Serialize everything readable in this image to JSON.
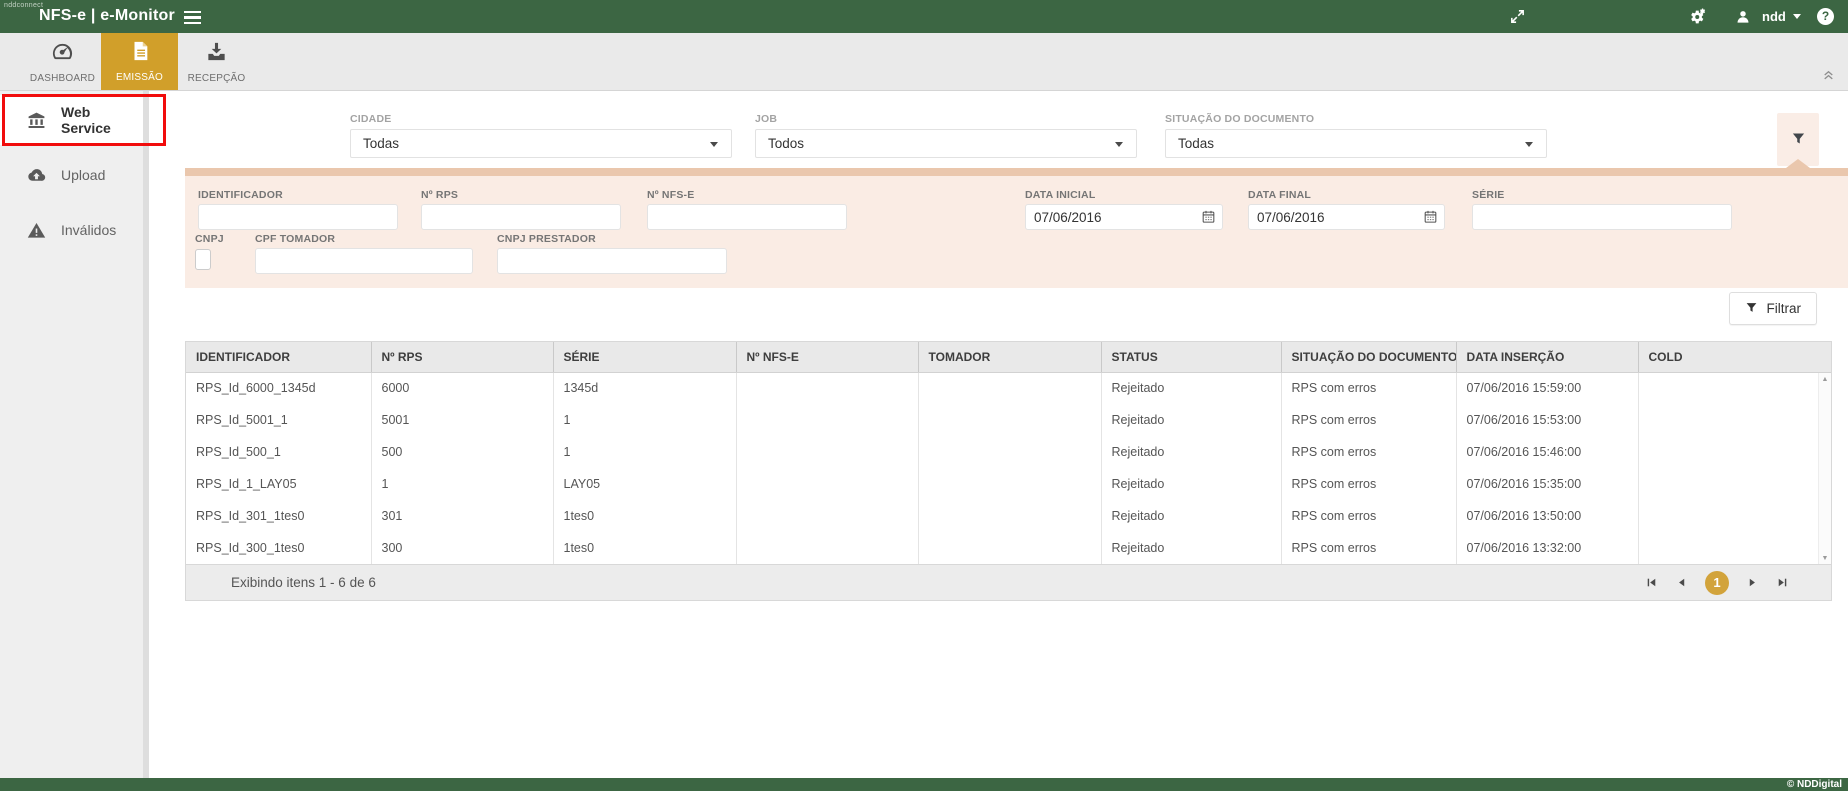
{
  "topbar": {
    "brand_small": "nddconnect",
    "title": "NFS-e | e-Monitor",
    "user_name": "ndd",
    "icons": [
      "menu-icon",
      "fullscreen-icon",
      "settings-icon",
      "user-icon",
      "caret-down-icon",
      "help-icon"
    ]
  },
  "toolbar": {
    "tabs": [
      {
        "label": "DASHBOARD",
        "icon": "speedometer-icon",
        "active": false
      },
      {
        "label": "EMISSÃO",
        "icon": "document-icon",
        "active": true
      },
      {
        "label": "RECEPÇÃO",
        "icon": "download-tray-icon",
        "active": false
      }
    ]
  },
  "sidebar": {
    "items": [
      {
        "label": "Web Service",
        "icon": "bank-icon",
        "active": true,
        "highlighted_by_red_annotation": true
      },
      {
        "label": "Upload",
        "icon": "cloud-upload-icon",
        "active": false
      },
      {
        "label": "Inválidos",
        "icon": "warning-icon",
        "active": false
      }
    ]
  },
  "filters": {
    "selects": [
      {
        "label": "CIDADE",
        "value": "Todas"
      },
      {
        "label": "JOB",
        "value": "Todos"
      },
      {
        "label": "SITUAÇÃO DO DOCUMENTO",
        "value": "Todas"
      }
    ],
    "fields": [
      {
        "label": "IDENTIFICADOR",
        "value": ""
      },
      {
        "label": "Nº RPS",
        "value": ""
      },
      {
        "label": "Nº NFS-E",
        "value": ""
      },
      {
        "label": "DATA INICIAL",
        "value": "07/06/2016"
      },
      {
        "label": "DATA FINAL",
        "value": "07/06/2016"
      },
      {
        "label": "SÉRIE",
        "value": ""
      }
    ],
    "fields2": [
      {
        "label": "CNPJ",
        "type": "checkbox",
        "checked": false
      },
      {
        "label": "CPF TOMADOR",
        "value": ""
      },
      {
        "label": "CNPJ PRESTADOR",
        "value": ""
      }
    ],
    "button_label": "Filtrar"
  },
  "table": {
    "columns": [
      "IDENTIFICADOR",
      "Nº RPS",
      "SÉRIE",
      "Nº NFS-E",
      "TOMADOR",
      "STATUS",
      "SITUAÇÃO DO DOCUMENTO",
      "DATA INSERÇÃO",
      "COLD"
    ],
    "rows": [
      [
        "RPS_Id_6000_1345d",
        "6000",
        "1345d",
        "",
        "",
        "Rejeitado",
        "RPS com erros",
        "07/06/2016 15:59:00",
        ""
      ],
      [
        "RPS_Id_5001_1",
        "5001",
        "1",
        "",
        "",
        "Rejeitado",
        "RPS com erros",
        "07/06/2016 15:53:00",
        ""
      ],
      [
        "RPS_Id_500_1",
        "500",
        "1",
        "",
        "",
        "Rejeitado",
        "RPS com erros",
        "07/06/2016 15:46:00",
        ""
      ],
      [
        "RPS_Id_1_LAY05",
        "1",
        "LAY05",
        "",
        "",
        "Rejeitado",
        "RPS com erros",
        "07/06/2016 15:35:00",
        ""
      ],
      [
        "RPS_Id_301_1tes0",
        "301",
        "1tes0",
        "",
        "",
        "Rejeitado",
        "RPS com erros",
        "07/06/2016 13:50:00",
        ""
      ],
      [
        "RPS_Id_300_1tes0",
        "300",
        "1tes0",
        "",
        "",
        "Rejeitado",
        "RPS com erros",
        "07/06/2016 13:32:00",
        ""
      ]
    ]
  },
  "pagination": {
    "summary": "Exibindo itens 1 - 6 de 6",
    "page": "1"
  },
  "footer": {
    "copyright": "© NDDigital"
  },
  "colors": {
    "brand_green": "#3C6643",
    "accent_gold": "#D19F2A",
    "pager_gold": "#D2A33B",
    "panel_peach": "#FAECE4",
    "panel_salmon": "#EAC7AD",
    "annotation_red": "#F10C0C"
  }
}
